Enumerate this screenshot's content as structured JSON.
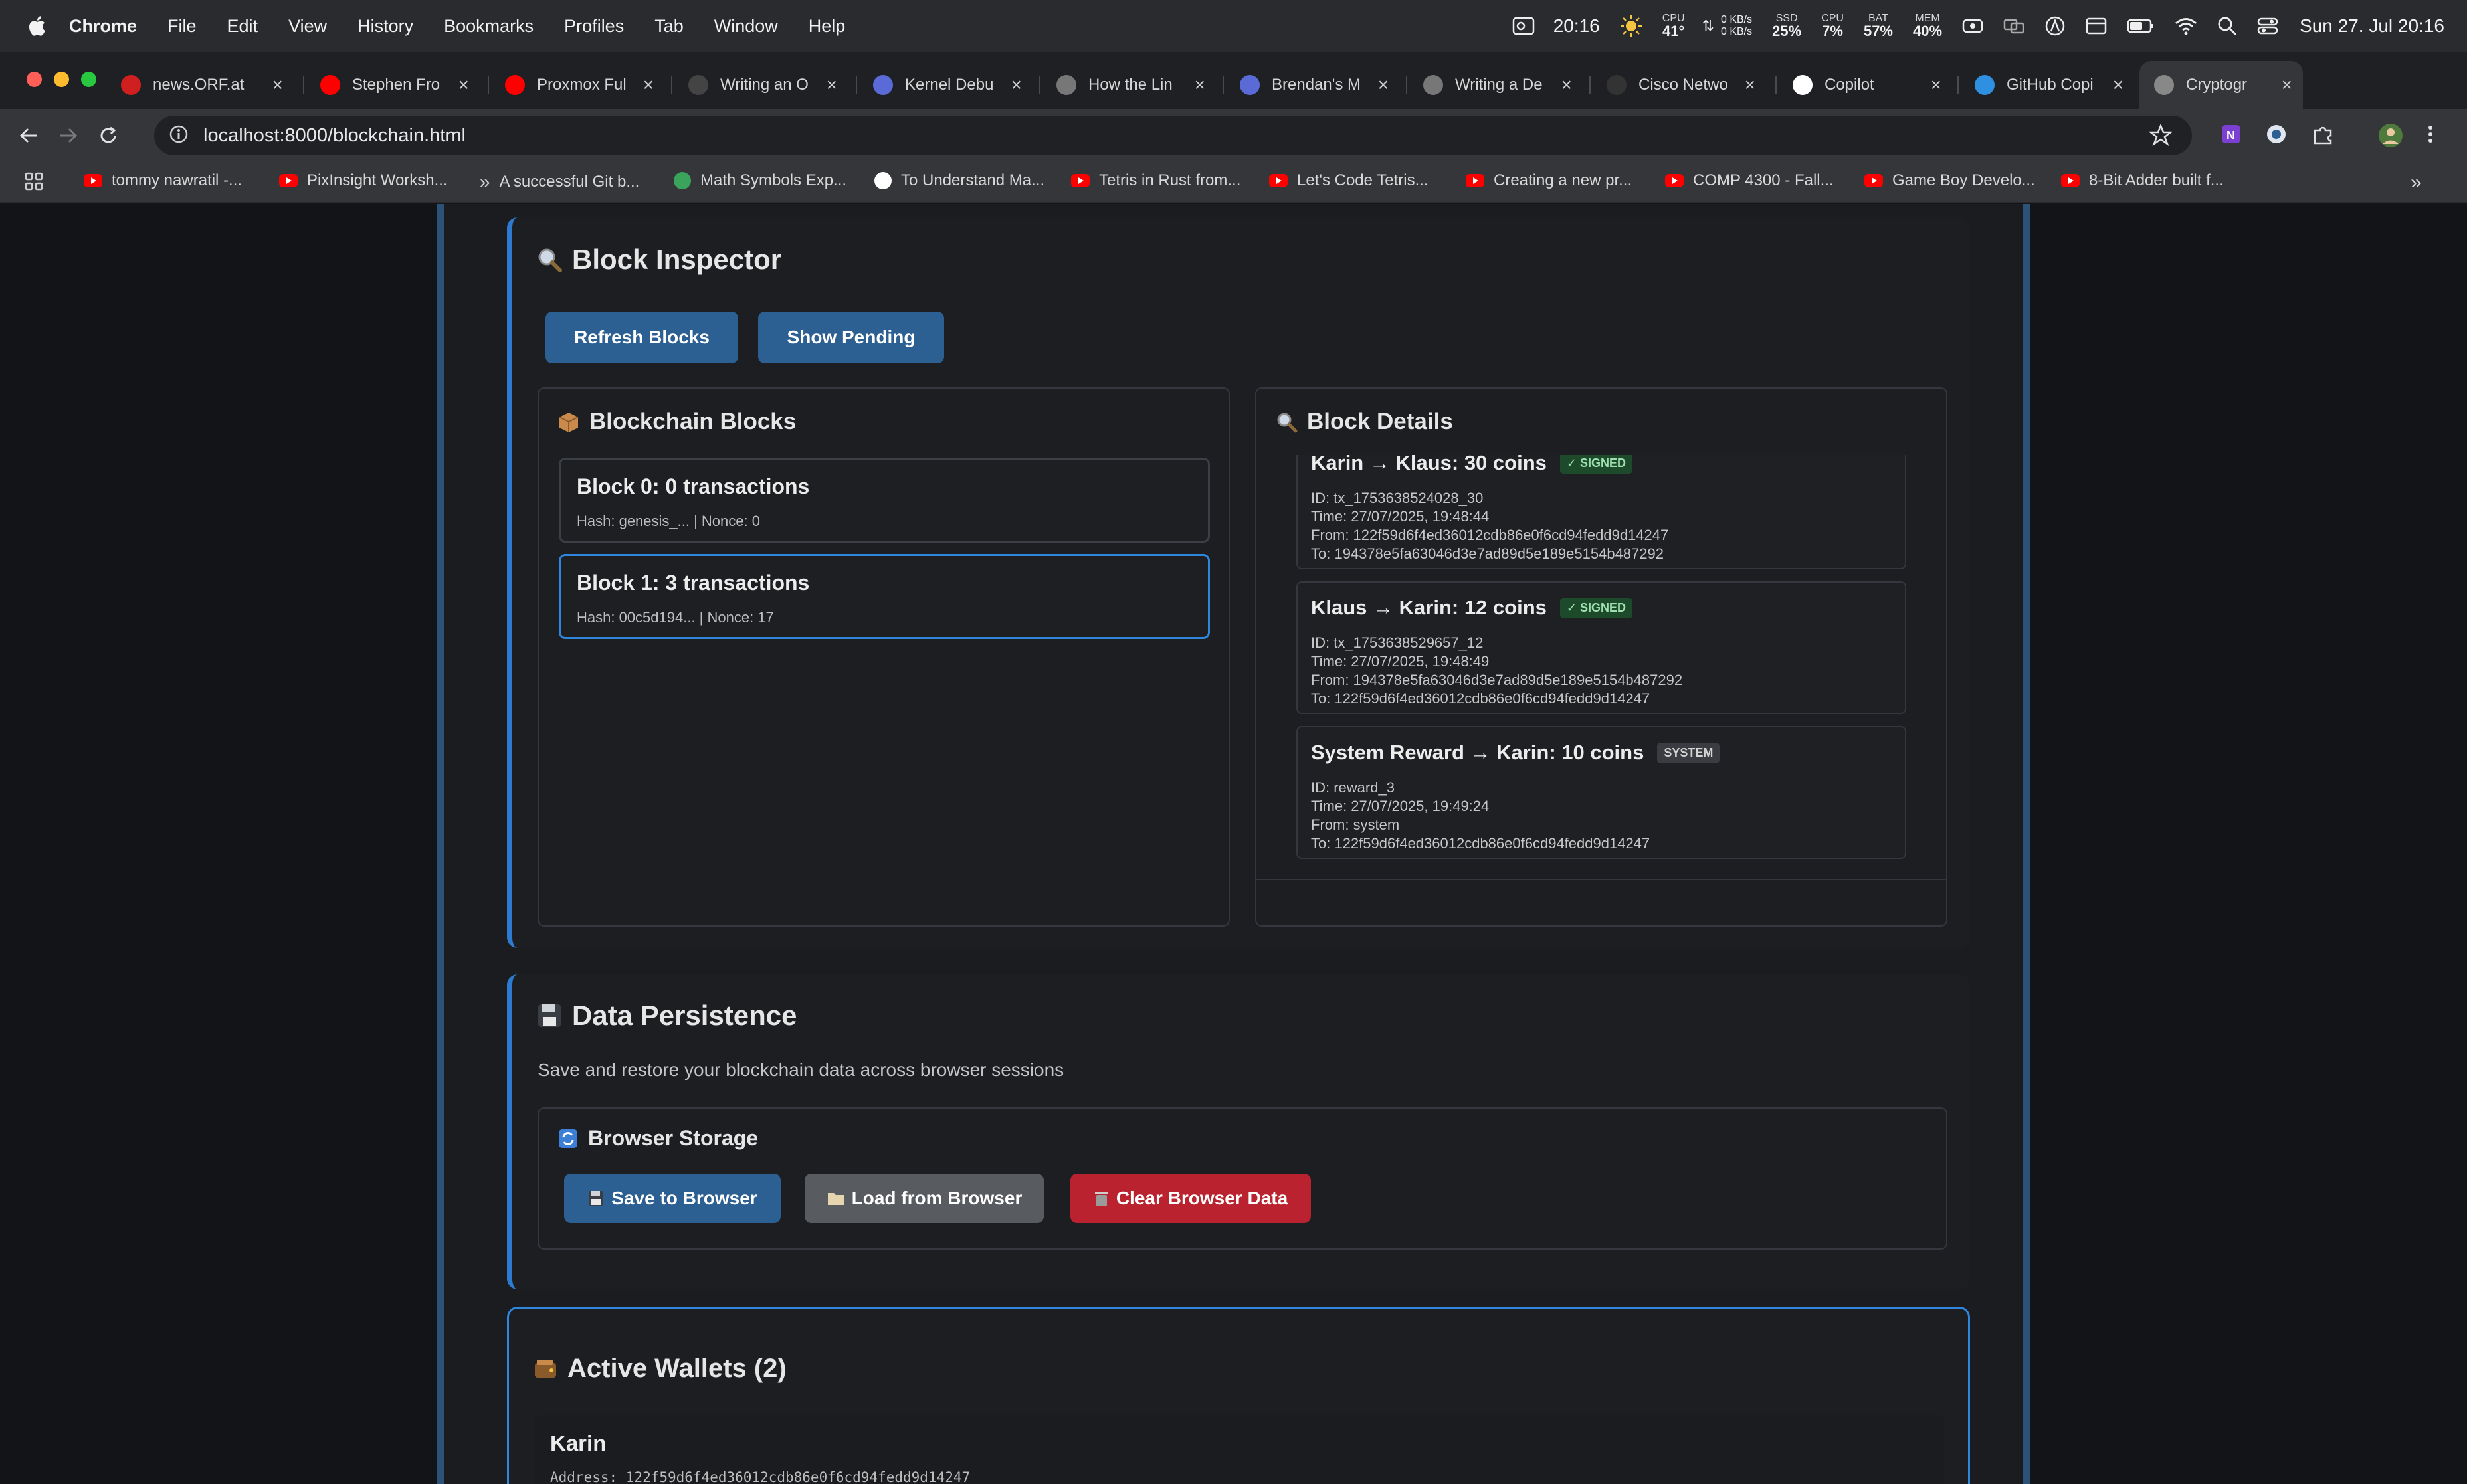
{
  "menubar": {
    "app": "Chrome",
    "items": [
      "File",
      "Edit",
      "View",
      "History",
      "Bookmarks",
      "Profiles",
      "Tab",
      "Window",
      "Help"
    ],
    "time": "20:16",
    "cpu_temp_label": "CPU",
    "cpu_temp": "41°",
    "net_up": "0 KB/s",
    "net_down": "0 KB/s",
    "ssd_label": "SSD",
    "ssd": "25%",
    "cpu_label": "CPU",
    "cpu": "7%",
    "bat_label": "BAT",
    "bat": "57%",
    "mem_label": "MEM",
    "mem": "40%",
    "date": "Sun 27. Jul  20:16"
  },
  "tabs": [
    {
      "title": "news.ORF.at",
      "icon": "orf-icon",
      "color": "#d01f1f"
    },
    {
      "title": "Stephen Fro",
      "icon": "youtube-icon",
      "color": "#ff0000"
    },
    {
      "title": "Proxmox Ful",
      "icon": "youtube-icon",
      "color": "#ff0000"
    },
    {
      "title": "Writing an O",
      "icon": "osdev-icon",
      "color": "#444444"
    },
    {
      "title": "Kernel Debu",
      "icon": "site-icon",
      "color": "#5a6bd8"
    },
    {
      "title": "How the Lin",
      "icon": "globe-icon",
      "color": "#777777"
    },
    {
      "title": "Brendan's M",
      "icon": "site-icon",
      "color": "#5a6bd8"
    },
    {
      "title": "Writing a De",
      "icon": "globe-icon",
      "color": "#777777"
    },
    {
      "title": "Cisco Netwo",
      "icon": "cisco-icon",
      "color": "#333333"
    },
    {
      "title": "Copilot",
      "icon": "github-icon",
      "color": "#ffffff"
    },
    {
      "title": "GitHub Copi",
      "icon": "vscode-icon",
      "color": "#2f8fe0"
    },
    {
      "title": "Cryptogr",
      "icon": "link-icon",
      "color": "#888888",
      "active": true
    }
  ],
  "address": {
    "url": "localhost:8000/blockchain.html"
  },
  "bookmarks": [
    {
      "label": "tommy nawratil -...",
      "icon": "youtube-icon"
    },
    {
      "label": "PixInsight Worksh...",
      "icon": "youtube-icon"
    },
    {
      "label": "A successful Git b...",
      "icon": "chevrons-icon"
    },
    {
      "label": "Math Symbols Exp...",
      "icon": "site-icon"
    },
    {
      "label": "To Understand Ma...",
      "icon": "medium-icon"
    },
    {
      "label": "Tetris in Rust from...",
      "icon": "youtube-icon"
    },
    {
      "label": "Let's Code Tetris...",
      "icon": "youtube-icon"
    },
    {
      "label": "Creating a new pr...",
      "icon": "youtube-icon"
    },
    {
      "label": "COMP 4300 - Fall...",
      "icon": "youtube-icon"
    },
    {
      "label": "Game Boy Develo...",
      "icon": "youtube-icon"
    },
    {
      "label": "8-Bit Adder built f...",
      "icon": "youtube-icon"
    }
  ],
  "inspector": {
    "title": "Block Inspector",
    "refresh_label": "Refresh Blocks",
    "pending_label": "Show Pending",
    "blocks_title": "Blockchain Blocks",
    "details_title": "Block Details",
    "blocks": [
      {
        "title": "Block 0: 0 transactions",
        "sub": "Hash: genesis_... | Nonce: 0"
      },
      {
        "title": "Block 1: 3 transactions",
        "sub": "Hash: 00c5d194... | Nonce: 17"
      }
    ],
    "transactions": [
      {
        "title": "Karin → Klaus: 30 coins",
        "badge": "✓ SIGNED",
        "id": "ID: tx_1753638524028_30",
        "time": "Time: 27/07/2025, 19:48:44",
        "from": "From: 122f59d6f4ed36012cdb86e0f6cd94fedd9d14247",
        "to": "To: 194378e5fa63046d3e7ad89d5e189e5154b487292"
      },
      {
        "title": "Klaus → Karin: 12 coins",
        "badge": "✓ SIGNED",
        "id": "ID: tx_1753638529657_12",
        "time": "Time: 27/07/2025, 19:48:49",
        "from": "From: 194378e5fa63046d3e7ad89d5e189e5154b487292",
        "to": "To: 122f59d6f4ed36012cdb86e0f6cd94fedd9d14247"
      },
      {
        "title": "System Reward → Karin: 10 coins",
        "badge": "SYSTEM",
        "id": "ID: reward_3",
        "time": "Time: 27/07/2025, 19:49:24",
        "from": "From: system",
        "to": "To: 122f59d6f4ed36012cdb86e0f6cd94fedd9d14247"
      }
    ]
  },
  "persistence": {
    "title": "Data Persistence",
    "description": "Save and restore your blockchain data across browser sessions",
    "storage_title": "Browser Storage",
    "save_label": "Save to Browser",
    "load_label": "Load from Browser",
    "clear_label": "Clear Browser Data"
  },
  "wallets": {
    "title": "Active Wallets (2)",
    "first_name": "Karin",
    "first_address": "Address: 122f59d6f4ed36012cdb86e0f6cd94fedd9d14247"
  },
  "colors": {
    "accent": "#2d7bd0",
    "button_blue": "#2c5f92",
    "button_red": "#b9222e",
    "button_gray": "#585b60",
    "signed_badge": "#1e4a2c"
  }
}
